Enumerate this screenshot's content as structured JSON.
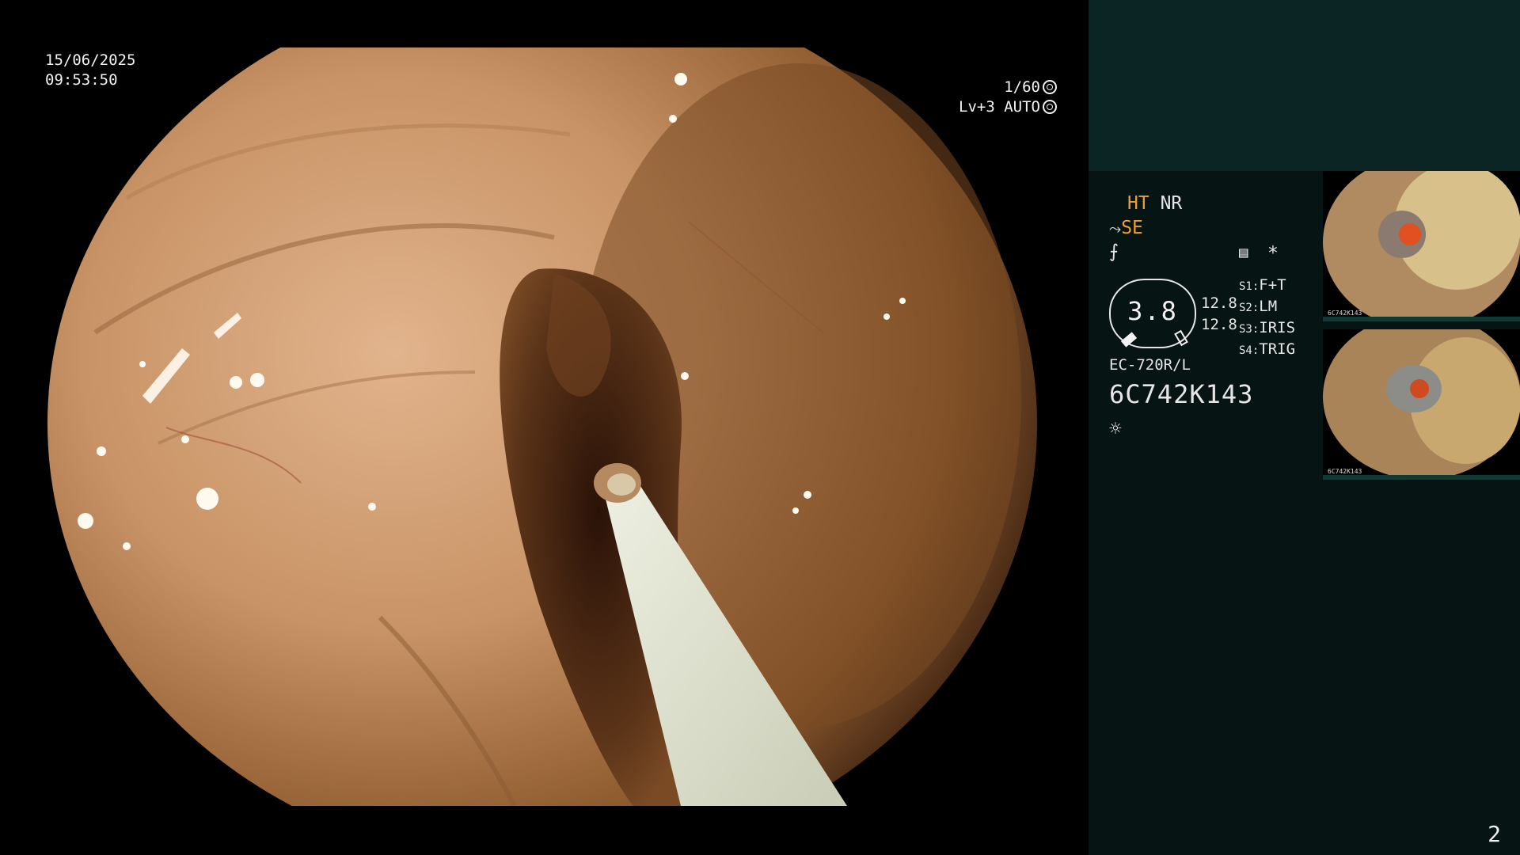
{
  "osd": {
    "date": "15/06/2025",
    "time": "09:53:50",
    "shutter": "1/60",
    "level": "Lv+3",
    "iris_mode": "AUTO"
  },
  "panel": {
    "ht": "HT",
    "nr": "NR",
    "se": "SE",
    "gauge_value": "3.8",
    "gauge_left": "12.8",
    "gauge_right": "12.8",
    "switches": [
      {
        "key": "S1:",
        "val": "F+T"
      },
      {
        "key": "S2:",
        "val": "LM"
      },
      {
        "key": "S3:",
        "val": "IRIS"
      },
      {
        "key": "S4:",
        "val": "TRIG"
      }
    ],
    "scope_model": "EC-720R/L",
    "serial": "6C742K143",
    "thumb1_label": "6C742K143",
    "thumb2_label": "6C742K143",
    "page_number": "2"
  },
  "icons": [
    "shutter-icon",
    "iris-icon",
    "hand-icon",
    "zigzag-icon",
    "menu-icon",
    "asterisk-icon",
    "light-icon"
  ],
  "colors": {
    "accent": "#f0a030",
    "panel_bg": "#061413",
    "panel_top": "#0b2524"
  }
}
